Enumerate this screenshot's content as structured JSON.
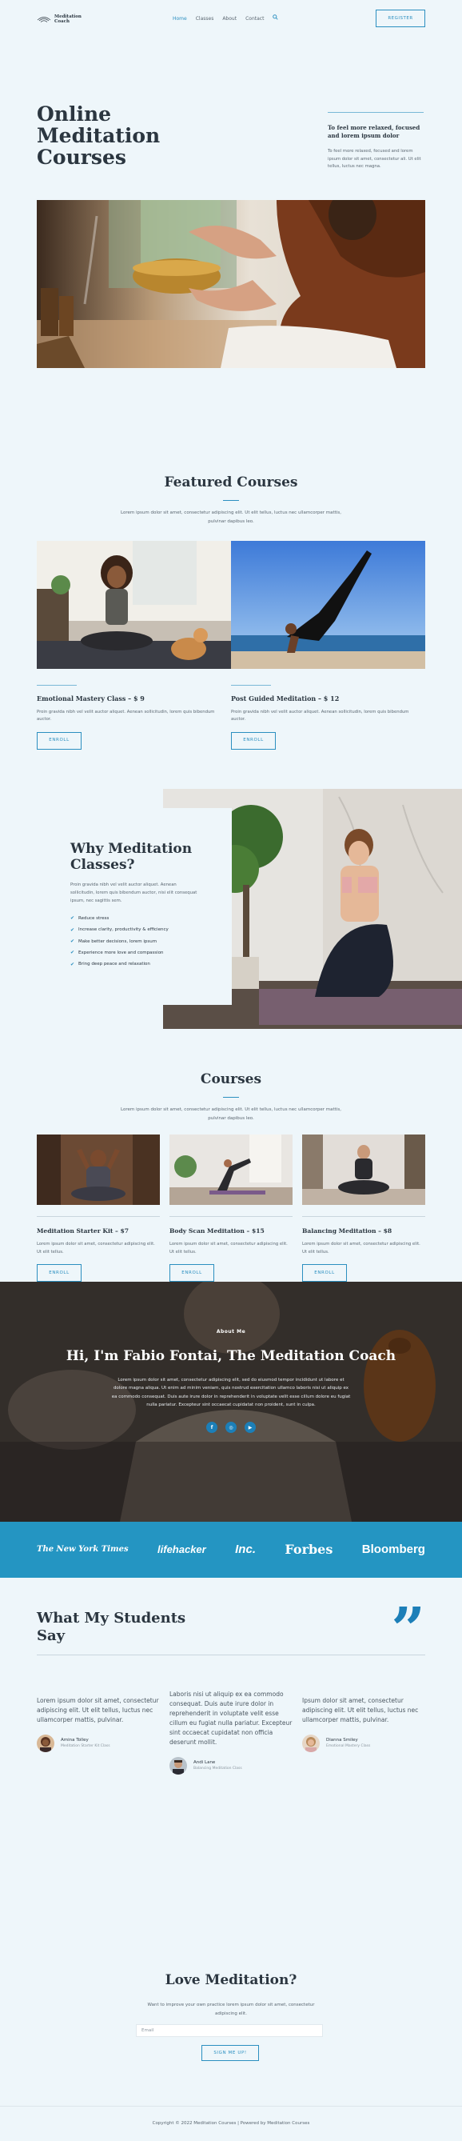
{
  "header": {
    "logo_line1": "Meditation",
    "logo_line2": "Coach",
    "nav": [
      "Home",
      "Classes",
      "About",
      "Contact"
    ],
    "register_label": "REGISTER"
  },
  "hero": {
    "title": "Online Meditation Courses",
    "aside_heading": "To feel more relaxed, focused and lorem ipsum dolor",
    "aside_text": "To feel more relaxed, focused and lorem ipsum dolor sit amet, consectetur ali. Ut elit tellus, luctus nec magna."
  },
  "featured": {
    "title": "Featured Courses",
    "subtitle": "Lorem ipsum dolor sit amet, consectetur adipiscing elit. Ut elit tellus, luctus nec ullamcorper mattis, pulvinar dapibus leo.",
    "cards": [
      {
        "title": "Emotional Mastery Class – $ 9",
        "text": "Proin gravida nibh vel velit auctor aliquet. Aenean sollicitudin, lorem quis bibendum auctor.",
        "button": "ENROLL"
      },
      {
        "title": "Post Guided Meditation – $ 12",
        "text": "Proin gravida nibh vel velit auctor aliquet. Aenean sollicitudin, lorem quis bibendum auctor.",
        "button": "ENROLL"
      }
    ]
  },
  "why": {
    "title": "Why Meditation Classes?",
    "text": "Proin gravida nibh vel velit auctor aliquet. Aenean sollicitudin, lorem quis bibendum auctor, nisi elit consequat ipsum, nec sagittis sem.",
    "items": [
      "Reduce stress",
      "Increase clarity, productivity & efficiency",
      "Make better decisions, lorem ipsum",
      "Experience more love and compassion",
      "Bring deep peace and relaxation"
    ]
  },
  "courses": {
    "title": "Courses",
    "subtitle": "Lorem ipsum dolor sit amet, consectetur adipiscing elit. Ut elit tellus, luctus nec ullamcorper mattis, pulvinar dapibus leo.",
    "cards": [
      {
        "title": "Meditation Starter Kit – $7",
        "text": "Lorem ipsum dolor sit amet, consectetur adipiscing elit. Ut elit tellus.",
        "button": "ENROLL"
      },
      {
        "title": "Body Scan Meditation – $15",
        "text": "Lorem ipsum dolor sit amet, consectetur adipiscing elit. Ut elit tellus.",
        "button": "ENROLL"
      },
      {
        "title": "Balancing Meditation – $8",
        "text": "Lorem ipsum dolor sit amet, consectetur adipiscing elit. Ut elit tellus.",
        "button": "ENROLL"
      }
    ]
  },
  "about": {
    "kicker": "About Me",
    "title": "Hi, I'm Fabio Fontai, The Meditation Coach",
    "text": "Lorem ipsum dolor sit amet, consectetur adipiscing elit, sed do eiusmod tempor incididunt ut labore et dolore magna aliqua. Ut enim ad minim veniam, quis nostrud exercitation ullamco laboris nisi ut aliquip ex ea commodo consequat. Duis aute irure dolor in reprehenderit in voluptate velit esse cillum dolore eu fugiat nulla pariatur. Excepteur sint occaecat cupidatat non proident, sunt in culpa.",
    "socials": [
      "f",
      "◎",
      "▶"
    ]
  },
  "press": [
    "The New York Times",
    "lifehacker",
    "Inc.",
    "Forbes",
    "Bloomberg"
  ],
  "testimonials": {
    "title": "What My Students Say",
    "items": [
      {
        "text": "Lorem ipsum dolor sit amet, consectetur adipiscing elit. Ut elit tellus, luctus nec ullamcorper mattis, pulvinar.",
        "name": "Amina Tolley",
        "role": "Meditation Starter Kit Class"
      },
      {
        "text": "Laboris nisi ut aliquip ex ea commodo consequat. Duis aute irure dolor in reprehenderit in voluptate velit esse cillum eu fugiat nulla pariatur. Excepteur sint occaecat cupidatat non officia deserunt mollit.",
        "name": "Andi Lane",
        "role": "Balancing Meditation Class"
      },
      {
        "text": "Ipsum dolor sit amet, consectetur adipiscing elit. Ut elit tellus, luctus nec ullamcorper mattis, pulvinar.",
        "name": "Dianna Smiley",
        "role": "Emotional Mastery Class"
      }
    ]
  },
  "newsletter": {
    "title": "Love Meditation?",
    "text": "Want to improve your own practice lorem ipsum dolor sit amet, consectetur adipiscing elit.",
    "placeholder": "Email",
    "button": "SIGN ME UP!"
  },
  "footer": "Copyright © 2022 Meditation Courses | Powered by Meditation Courses",
  "colors": {
    "accent": "#2b8fc0",
    "press_band": "#2495c2",
    "background": "#eef6fa",
    "heading": "#2b3640"
  }
}
